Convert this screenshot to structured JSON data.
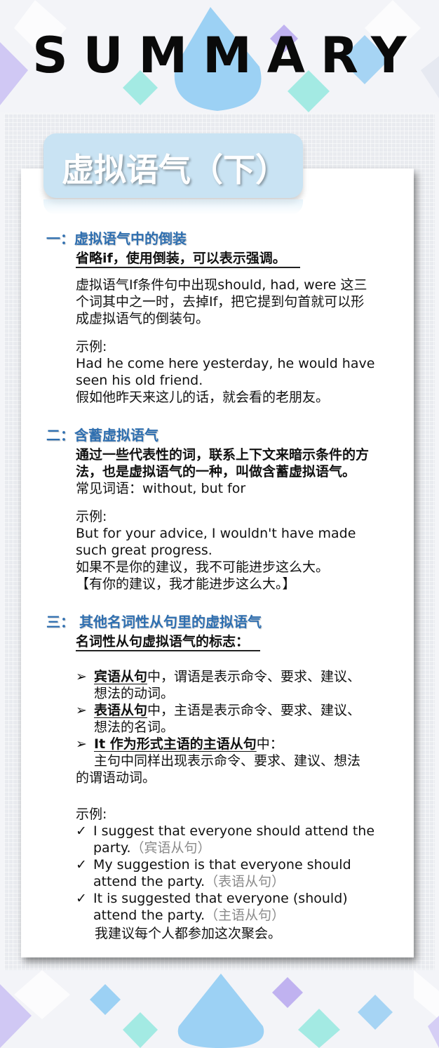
{
  "header": {
    "title": "SUMMARY"
  },
  "tab": {
    "title": "虚拟语气（下）"
  },
  "sections": {
    "s1": {
      "heading": "一：虚拟语气中的倒装",
      "subheading": "省略if，使用倒装，可以表示强调。",
      "body": [
        "虚拟语气If条件句中出现should, had, were 这三",
        "个词其中之一时，去掉If，把它提到句首就可以形",
        "成虚拟语气的倒装句。"
      ],
      "example_label": "示例:",
      "example": [
        "Had he come here yesterday,  he would have",
        "seen his old friend.",
        "假如他昨天来这儿的话，就会看的老朋友。"
      ]
    },
    "s2": {
      "heading": "二：含蓄虚拟语气",
      "bold_body": [
        "通过一些代表性的词，联系上下文来暗示条件的方",
        "法，也是虚拟语气的一种，叫做含蓄虚拟语气。"
      ],
      "common": "常见词语：without, but for",
      "example_label": "示例:",
      "example": [
        "But for your advice, I wouldn't  have made",
        "such great progress.",
        "如果不是你的建议，我不可能进步这么大。",
        "【有你的建议，我才能进步这么大。】"
      ]
    },
    "s3": {
      "heading": "三：  其他名词性从句里的虚拟语气",
      "subheading": "名词性从句虚拟语气的标志：",
      "bullets": [
        {
          "key": "宾语从句",
          "rest": "中，谓语是表示命令、要求、建议、",
          "cont": "想法的动词。"
        },
        {
          "key": "表语从句",
          "rest": "中，主语是表示命令、要求、建议、",
          "cont": "想法的名词。"
        },
        {
          "key": "It 作为形式主语的主语从句",
          "rest": "中：",
          "cont": ""
        }
      ],
      "bullet3_body": [
        "主句中同样出现表示命令、要求、建议、想法",
        "的谓语动词。"
      ],
      "bullet_mark": "➢",
      "example_label": "示例:",
      "check_mark": "✓",
      "examples": [
        {
          "line1": "I suggest that everyone should attend the",
          "line2": "party.",
          "note": "（宾语从句）"
        },
        {
          "line1": "My suggestion is that everyone should",
          "line2": "attend the party.",
          "note": "（表语从句）"
        },
        {
          "line1": "It is suggested that everyone (should)",
          "line2": "attend the party.",
          "note": "（主语从句）"
        }
      ],
      "translation": "我建议每个人都参加这次聚会。"
    }
  },
  "colors": {
    "heading": "#2f6fb0",
    "tab": "#c9e3f3",
    "purple": "#b7a9ee",
    "blue": "#7fc3f2",
    "teal": "#7fe6dc"
  }
}
